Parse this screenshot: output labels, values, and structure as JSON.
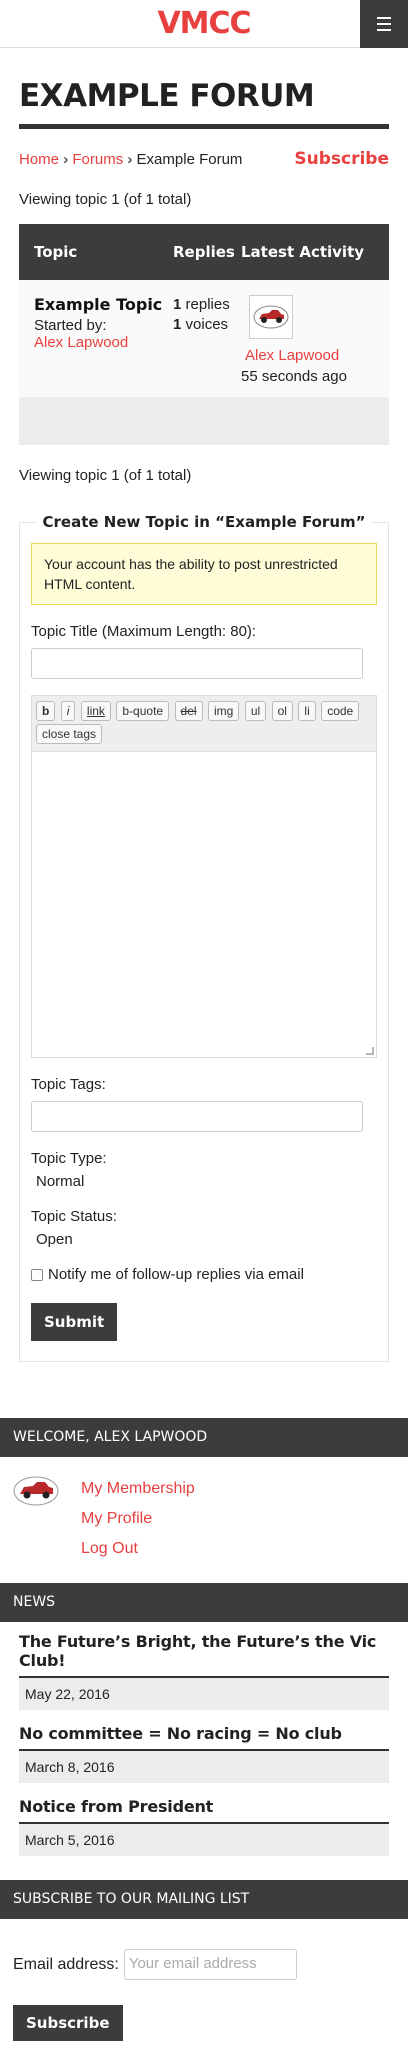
{
  "header": {
    "brand": "VMCC"
  },
  "page": {
    "title": "EXAMPLE FORUM",
    "breadcrumb": {
      "home": "Home",
      "forums": "Forums",
      "current": "Example Forum",
      "separator": "›"
    },
    "subscribe": "Subscribe",
    "viewing_top": "Viewing topic 1 (of 1 total)",
    "viewing_bottom": "Viewing topic 1 (of 1 total)"
  },
  "topics_table": {
    "headers": {
      "topic": "Topic",
      "replies": "Replies",
      "latest": "Latest Activity"
    },
    "rows": [
      {
        "title": "Example Topic",
        "started_by_label": "Started by:",
        "author": "Alex Lapwood",
        "replies_count": "1",
        "replies_label": "replies",
        "voices_count": "1",
        "voices_label": "voices",
        "latest_author": "Alex Lapwood",
        "latest_time": "55 seconds ago"
      }
    ]
  },
  "new_topic_form": {
    "legend": "Create New Topic in “Example Forum”",
    "notice": "Your account has the ability to post unrestricted HTML content.",
    "title_label": "Topic Title (Maximum Length: 80):",
    "toolbar": [
      "b",
      "i",
      "link",
      "b-quote",
      "del",
      "img",
      "ul",
      "ol",
      "li",
      "code",
      "close tags"
    ],
    "tags_label": "Topic Tags:",
    "type_label": "Topic Type:",
    "type_value": "Normal",
    "status_label": "Topic Status:",
    "status_value": "Open",
    "notify_label": "Notify me of follow-up replies via email",
    "submit": "Submit"
  },
  "welcome_widget": {
    "heading": "WELCOME, ALEX LAPWOOD",
    "links": [
      "My Membership",
      "My Profile",
      "Log Out"
    ]
  },
  "news_widget": {
    "heading": "NEWS",
    "items": [
      {
        "title": "The Future’s Bright, the Future’s the Vic Club!",
        "date": "May 22, 2016"
      },
      {
        "title": "No committee = No racing = No club",
        "date": "March 8, 2016"
      },
      {
        "title": "Notice from President",
        "date": "March 5, 2016"
      }
    ]
  },
  "mailing_widget": {
    "heading": "SUBSCRIBE TO OUR MAILING LIST",
    "email_label": "Email address:",
    "email_placeholder": "Your email address",
    "button": "Subscribe"
  },
  "colors": {
    "accent": "#e8403f",
    "dark": "#3c3c3c"
  }
}
